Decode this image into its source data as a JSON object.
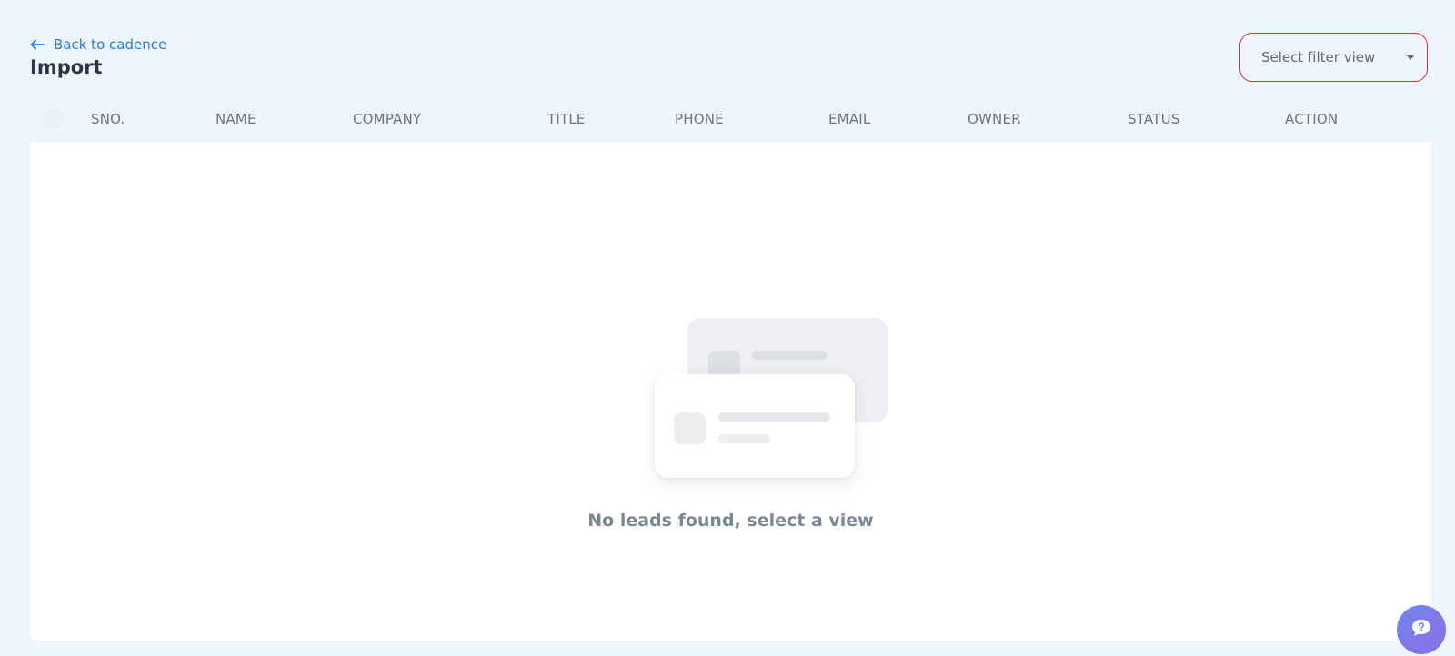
{
  "header": {
    "back_label": "Back to cadence",
    "title": "Import"
  },
  "filter": {
    "placeholder": "Select filter view"
  },
  "table": {
    "columns": [
      "SNO.",
      "NAME",
      "COMPANY",
      "TITLE",
      "PHONE",
      "EMAIL",
      "OWNER",
      "STATUS",
      "ACTION"
    ]
  },
  "empty_state": {
    "message": "No leads found, select a view"
  },
  "icons": {
    "back": "arrow-left-icon",
    "dropdown": "caret-down-icon",
    "help": "chat-question-icon"
  },
  "colors": {
    "accent": "#2979e0",
    "background": "#eef5fc",
    "filter_border": "#e02a2a",
    "help_button": "#7b7ff0"
  }
}
